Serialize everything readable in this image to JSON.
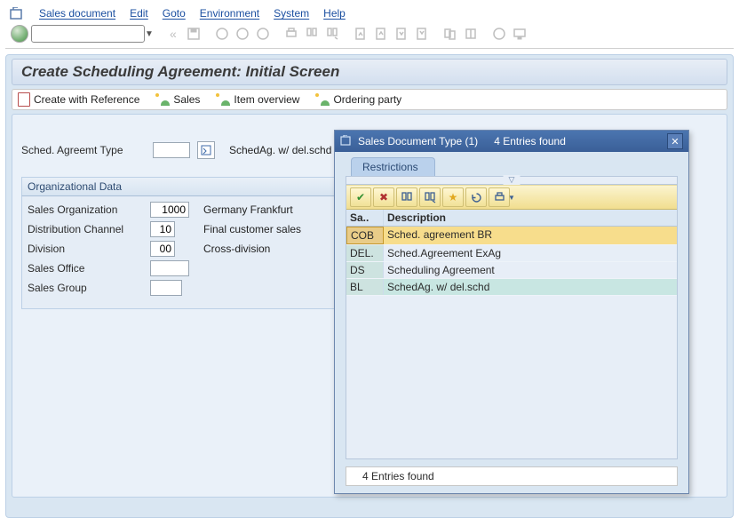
{
  "menu": {
    "items": [
      "Sales document",
      "Edit",
      "Goto",
      "Environment",
      "System",
      "Help"
    ]
  },
  "page": {
    "title": "Create Scheduling Agreement: Initial Screen"
  },
  "app_toolbar": {
    "create_ref": "Create with Reference",
    "sales": "Sales",
    "item_ov": "Item overview",
    "order_party": "Ordering party"
  },
  "fields": {
    "sched_type_label": "Sched. Agreemt Type",
    "sched_type_value": "",
    "sched_type_desc": "SchedAg. w/ del.schd"
  },
  "org": {
    "header": "Organizational Data",
    "rows": [
      {
        "label": "Sales Organization",
        "value": "1000",
        "desc": "Germany Frankfurt"
      },
      {
        "label": "Distribution Channel",
        "value": "10",
        "desc": "Final customer sales"
      },
      {
        "label": "Division",
        "value": "00",
        "desc": "Cross-division"
      },
      {
        "label": "Sales Office",
        "value": "",
        "desc": ""
      },
      {
        "label": "Sales Group",
        "value": "",
        "desc": ""
      }
    ]
  },
  "popup": {
    "title_left": "Sales Document Type (1)",
    "title_right": "4 Entries found",
    "tab": "Restrictions",
    "cols": {
      "c1": "Sa..",
      "c2": "Description"
    },
    "rows": [
      {
        "c1": "COB",
        "c2": "Sched. agreement BR",
        "hl": true
      },
      {
        "c1": "DEL.",
        "c2": "Sched.Agreement ExAg"
      },
      {
        "c1": "DS",
        "c2": "Scheduling Agreement"
      },
      {
        "c1": "BL",
        "c2": "SchedAg. w/ del.schd"
      }
    ],
    "status": "4 Entries found"
  }
}
